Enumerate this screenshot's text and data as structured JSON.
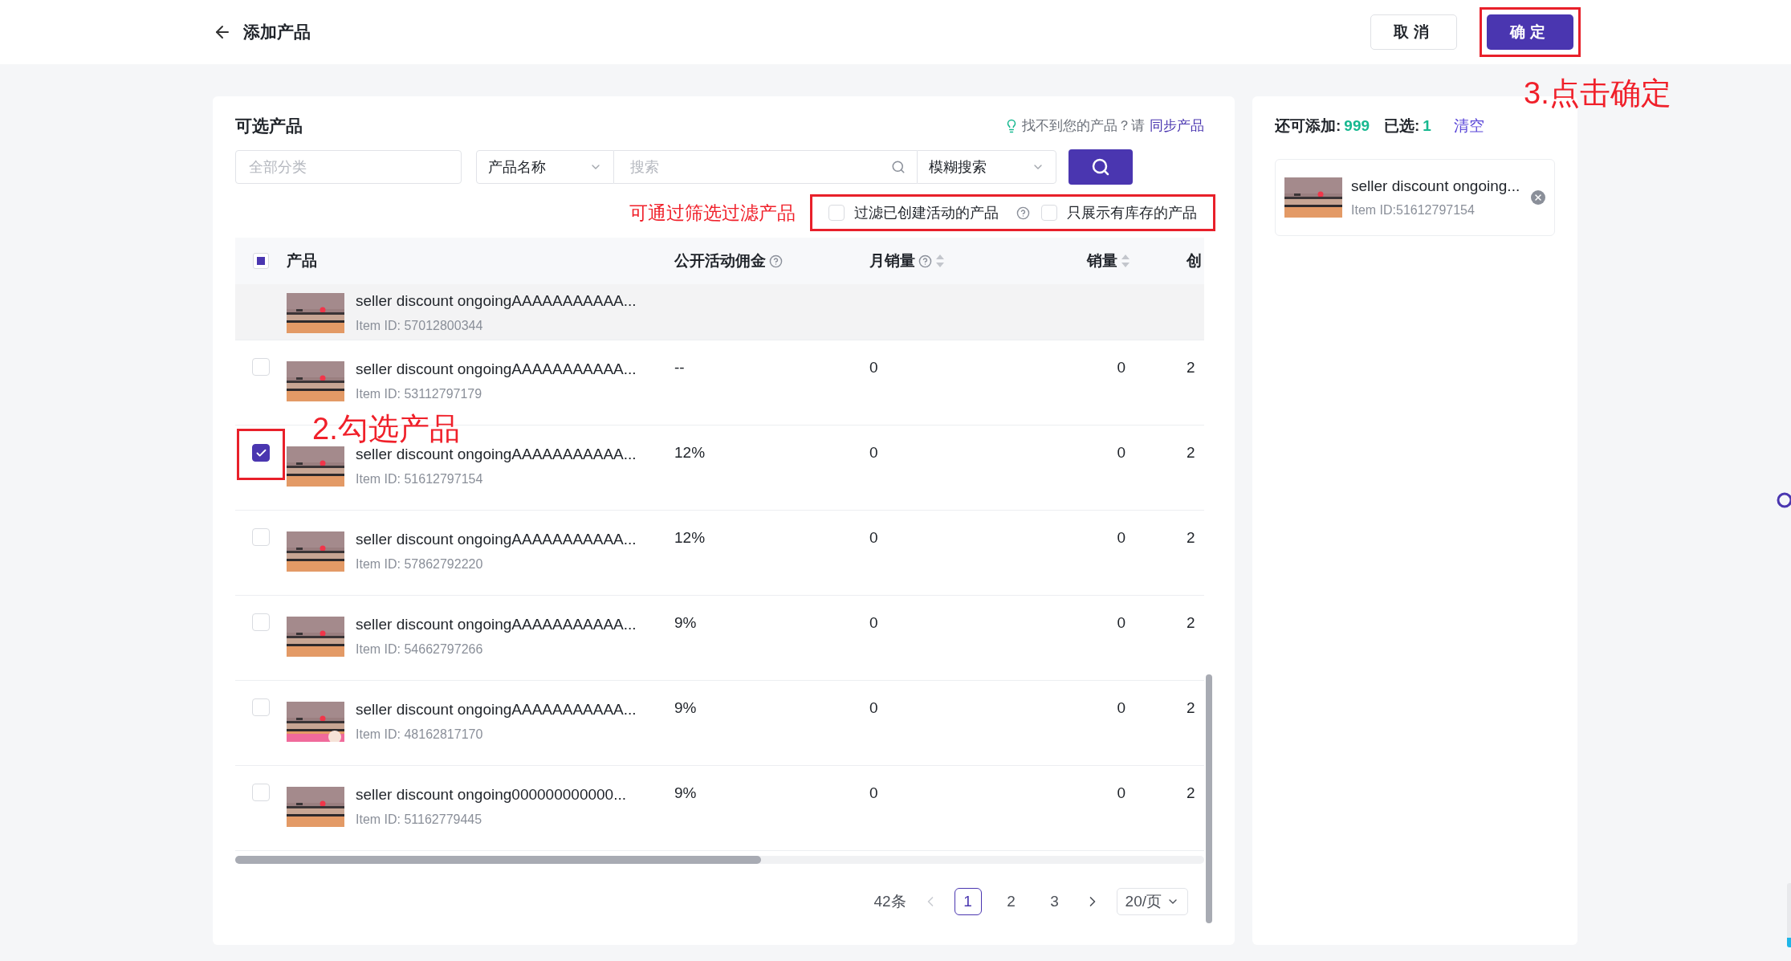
{
  "header": {
    "title": "添加产品",
    "buttons": [
      {
        "label": "取消",
        "kind": "secondary"
      },
      {
        "label": "确定",
        "kind": "primary"
      }
    ]
  },
  "panel": {
    "title": "可选产品",
    "hint": "找不到您的产品？请",
    "hint_link": "同步产品"
  },
  "filters": {
    "category": {
      "placeholder": "全部分类"
    },
    "field_select": {
      "value": "产品名称"
    },
    "search": {
      "placeholder": "搜索"
    },
    "mode_select": {
      "value": "模糊搜索"
    },
    "options": [
      {
        "label": "过滤已创建活动的产品",
        "checked": false,
        "kind": "help"
      },
      {
        "label": "只展示有库存的产品",
        "checked": false,
        "kind": "plain"
      }
    ]
  },
  "table": {
    "select_all": {
      "indeterminate": true
    },
    "columns": [
      {
        "label": "产品",
        "kind": "plain"
      },
      {
        "label": "公开活动佣金",
        "kind": "help"
      },
      {
        "label": "月销量",
        "kind": "help_sortable"
      },
      {
        "label": "销量",
        "kind": "sortable"
      },
      {
        "label": "创",
        "kind": "plain"
      }
    ],
    "rows": [
      {
        "name": "seller discount ongoingAAAAAAAAAAA...",
        "item_id": "Item ID: 57012800344",
        "commission": "",
        "monthly_sales": "",
        "sales": "",
        "column_5": "",
        "checked": false,
        "hovered": true
      },
      {
        "name": "seller discount ongoingAAAAAAAAAAA...",
        "item_id": "Item ID: 53112797179",
        "commission": "--",
        "monthly_sales": "0",
        "sales": "0",
        "column_5": "2",
        "checked": false,
        "hovered": false
      },
      {
        "name": "seller discount ongoingAAAAAAAAAAA...",
        "item_id": "Item ID: 51612797154",
        "commission": "12%",
        "monthly_sales": "0",
        "sales": "0",
        "column_5": "2",
        "checked": true,
        "hovered": false
      },
      {
        "name": "seller discount ongoingAAAAAAAAAAA...",
        "item_id": "Item ID: 57862792220",
        "commission": "12%",
        "monthly_sales": "0",
        "sales": "0",
        "column_5": "2",
        "checked": false,
        "hovered": false
      },
      {
        "name": "seller discount ongoingAAAAAAAAAAA...",
        "item_id": "Item ID: 54662797266",
        "commission": "9%",
        "monthly_sales": "0",
        "sales": "0",
        "column_5": "2",
        "checked": false,
        "hovered": false
      },
      {
        "name": "seller discount ongoingAAAAAAAAAAA...",
        "item_id": "Item ID: 48162817170",
        "commission": "9%",
        "monthly_sales": "0",
        "sales": "0",
        "column_5": "2",
        "checked": false,
        "hovered": false
      },
      {
        "name": "seller discount ongoing000000000000...",
        "item_id": "Item ID: 51162779445",
        "commission": "9%",
        "monthly_sales": "0",
        "sales": "0",
        "column_5": "2",
        "checked": false,
        "hovered": false
      }
    ]
  },
  "pagination": {
    "total": "42条",
    "prev_disabled": true,
    "pages": [
      {
        "label": "1",
        "selected": true
      },
      {
        "label": "2",
        "selected": false
      },
      {
        "label": "3",
        "selected": false
      }
    ],
    "page_size": "20/页"
  },
  "selected_panel": {
    "remaining_label": "还可添加:",
    "remaining": "999",
    "selected_label": "已选:",
    "selected_count": "1",
    "clear": "清空",
    "items": [
      {
        "name": "seller discount ongoing...",
        "item_id": "Item ID:51612797154"
      }
    ]
  },
  "annotations": {
    "filter_note": "可通过筛选过滤产品",
    "step2": "2.勾选产品",
    "step3": "3.点击确定"
  }
}
